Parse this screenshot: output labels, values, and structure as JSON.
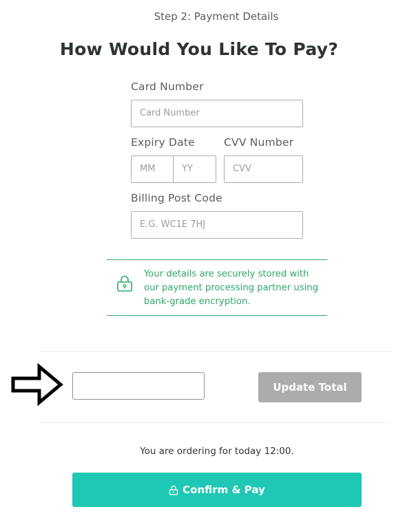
{
  "header": {
    "step": "Step 2: Payment Details",
    "title": "How Would You Like To Pay?"
  },
  "form": {
    "card_number": {
      "label": "Card Number",
      "placeholder": "Card Number"
    },
    "expiry": {
      "label": "Expiry Date",
      "month_placeholder": "MM",
      "year_placeholder": "YY"
    },
    "cvv": {
      "label": "CVV Number",
      "placeholder": "CVV"
    },
    "billing": {
      "label": "Billing Post Code",
      "placeholder": "E.G. WC1E 7HJ"
    }
  },
  "security_notice": {
    "icon": "lock-icon",
    "text": "Your details are securely stored with our payment processing partner using bank-grade encryption."
  },
  "promo": {
    "arrow_icon": "right-arrow-icon",
    "input_value": "",
    "update_label": "Update Total"
  },
  "order": {
    "schedule_text": "You are ordering for today 12:00.",
    "confirm_label": "Confirm & Pay",
    "confirm_icon": "lock-icon"
  },
  "colors": {
    "accent_teal": "#1fc8b4",
    "secure_green": "#2fa766",
    "disabled_grey": "#abadad"
  }
}
